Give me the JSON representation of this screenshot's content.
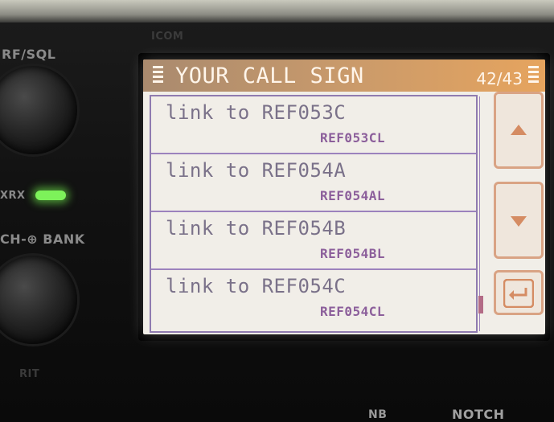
{
  "panel": {
    "labels": {
      "rf_sql": "RF/SQL",
      "xrx": "XRX",
      "bank": "CH-⊕ BANK",
      "rit": "RIT",
      "nb": "NB",
      "notch": "NOTCH",
      "icom": "ICOM"
    }
  },
  "screen": {
    "title": "YOUR CALL SIGN",
    "page": "42/43",
    "items": [
      {
        "label": "link to REF053C",
        "callsign": "REF053CL"
      },
      {
        "label": "link to REF054A",
        "callsign": "REF054AL"
      },
      {
        "label": "link to REF054B",
        "callsign": "REF054BL"
      },
      {
        "label": "link to REF054C",
        "callsign": "REF054CL"
      }
    ],
    "buttons": {
      "up_icon": "triangle-up-icon",
      "down_icon": "triangle-down-icon",
      "back_icon": "return-arrow-icon"
    },
    "colors": {
      "title_bar_start": "#a98a6e",
      "title_bar_end": "#e6a45e",
      "item_text": "#7a7189",
      "callsign_text": "#8c5f9b",
      "button_border": "#d9a384"
    }
  }
}
